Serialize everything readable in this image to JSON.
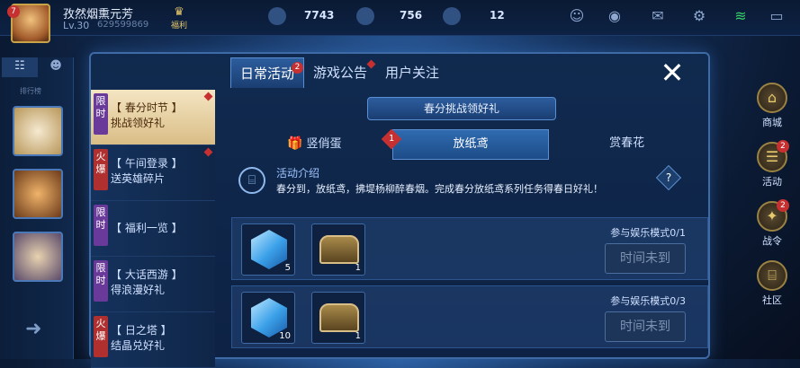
{
  "player": {
    "level_badge": "7",
    "name": "孜然烟熏元芳",
    "level": "Lv.30",
    "id_text": "629599869",
    "welfare_label": "福利"
  },
  "currency": [
    {
      "icon": "diamond-icon",
      "value": "7743"
    },
    {
      "icon": "coupon-icon",
      "value": "756"
    },
    {
      "icon": "gem-icon",
      "value": "12"
    }
  ],
  "sidebar_left": {
    "rank_label": "排行榜"
  },
  "tabs": [
    {
      "label": "日常活动",
      "badge": "2",
      "active": true
    },
    {
      "label": "游戏公告",
      "badge": "",
      "active": false
    },
    {
      "label": "用户关注",
      "badge": "",
      "active": false
    }
  ],
  "activity_list": [
    {
      "tag": "限时",
      "tag_type": "limit",
      "label": "【 春分时节 】\n挑战领好礼",
      "active": true
    },
    {
      "tag": "火爆",
      "tag_type": "hot",
      "label": "【 午间登录 】\n送英雄碎片",
      "active": false
    },
    {
      "tag": "限时",
      "tag_type": "limit",
      "label": "【 福利一览 】",
      "active": false
    },
    {
      "tag": "限时",
      "tag_type": "limit",
      "label": "【 大话西游 】\n得浪漫好礼",
      "active": false
    },
    {
      "tag": "火爆",
      "tag_type": "hot",
      "label": "【 日之塔 】\n结晶兑好礼",
      "active": false
    }
  ],
  "content": {
    "banner": "春分挑战领好礼",
    "subtabs": [
      {
        "label": "竖俏蛋",
        "active": false,
        "badge": ""
      },
      {
        "label": "放纸鸢",
        "active": true,
        "badge": "1"
      },
      {
        "label": "赏春花",
        "active": false,
        "badge": ""
      }
    ],
    "intro_title": "活动介绍",
    "intro_text": "春分到，放纸鸢，拂堤杨柳醉春烟。完成春分放纸鸢系列任务得春日好礼！",
    "tasks": [
      {
        "crystal_qty": "5",
        "chest_qty": "1",
        "mode": "参与娱乐模式0/1",
        "button": "时间未到"
      },
      {
        "crystal_qty": "10",
        "chest_qty": "1",
        "mode": "参与娱乐模式0/3",
        "button": "时间未到"
      }
    ]
  },
  "right_menu": [
    {
      "label": "商城",
      "icon": "shop-icon",
      "badge": ""
    },
    {
      "label": "活动",
      "icon": "activity-icon",
      "badge": "2"
    },
    {
      "label": "战令",
      "icon": "battlepass-icon",
      "badge": "2"
    },
    {
      "label": "社区",
      "icon": "community-icon",
      "badge": ""
    }
  ],
  "colors": {
    "accent": "#5b8fd1",
    "badge_red": "#c73030",
    "gold": "#d9bd86"
  }
}
